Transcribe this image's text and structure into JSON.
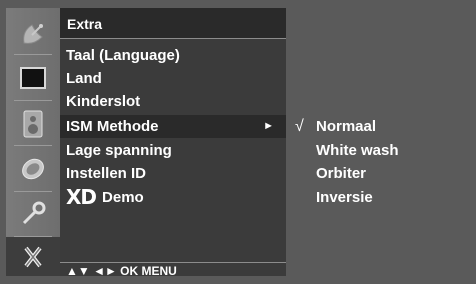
{
  "menu": {
    "title": "Extra",
    "items": [
      {
        "label": "Taal (Language)"
      },
      {
        "label": "Land"
      },
      {
        "label": "Kinderslot"
      },
      {
        "label": "ISM Methode",
        "selected": true,
        "arrow": "►"
      },
      {
        "label": "Lage spanning"
      },
      {
        "label": "Instellen ID"
      },
      {
        "label": "Demo",
        "logo": "XD"
      }
    ],
    "nav_hint": "▲▼ ◄► OK MENU"
  },
  "submenu": {
    "items": [
      {
        "label": "Normaal",
        "checked": true,
        "check_mark": "√"
      },
      {
        "label": "White wash"
      },
      {
        "label": "Orbiter"
      },
      {
        "label": "Inversie"
      }
    ]
  },
  "icons": [
    "satellite-dish-icon",
    "screen-icon",
    "speaker-icon",
    "clock-icon",
    "key-icon",
    "tools-icon"
  ]
}
